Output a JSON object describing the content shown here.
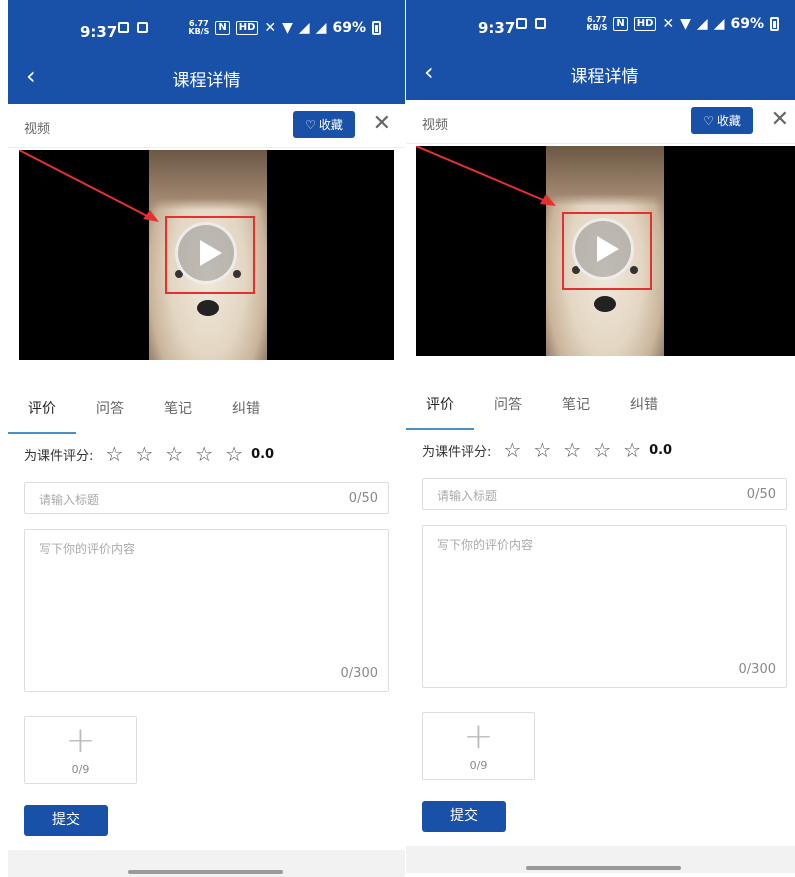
{
  "status": {
    "time": "9:37",
    "speed_top": "6.77",
    "speed_bottom": "KB/S",
    "badge": "HD",
    "battery": "69%"
  },
  "nav": {
    "back_icon": "chevron-left-icon",
    "title": "课程详情"
  },
  "video_header": {
    "label": "视频",
    "favorite": "收藏",
    "close": "✕"
  },
  "tabs": [
    "评价",
    "问答",
    "笔记",
    "纠错"
  ],
  "rating": {
    "label": "为课件评分:",
    "stars": [
      "☆",
      "☆",
      "☆",
      "☆",
      "☆"
    ],
    "star_count": 5,
    "score": "0.0"
  },
  "title_input": {
    "placeholder": "请输入标题",
    "counter": "0/50"
  },
  "content_input": {
    "placeholder": "写下你的评价内容",
    "counter": "0/300"
  },
  "upload": {
    "plus": "+",
    "counter": "0/9"
  },
  "submit": "提交",
  "colors": {
    "brand": "#1a51a8",
    "highlight": "#e53030",
    "tab_underline": "#4a90c8"
  }
}
